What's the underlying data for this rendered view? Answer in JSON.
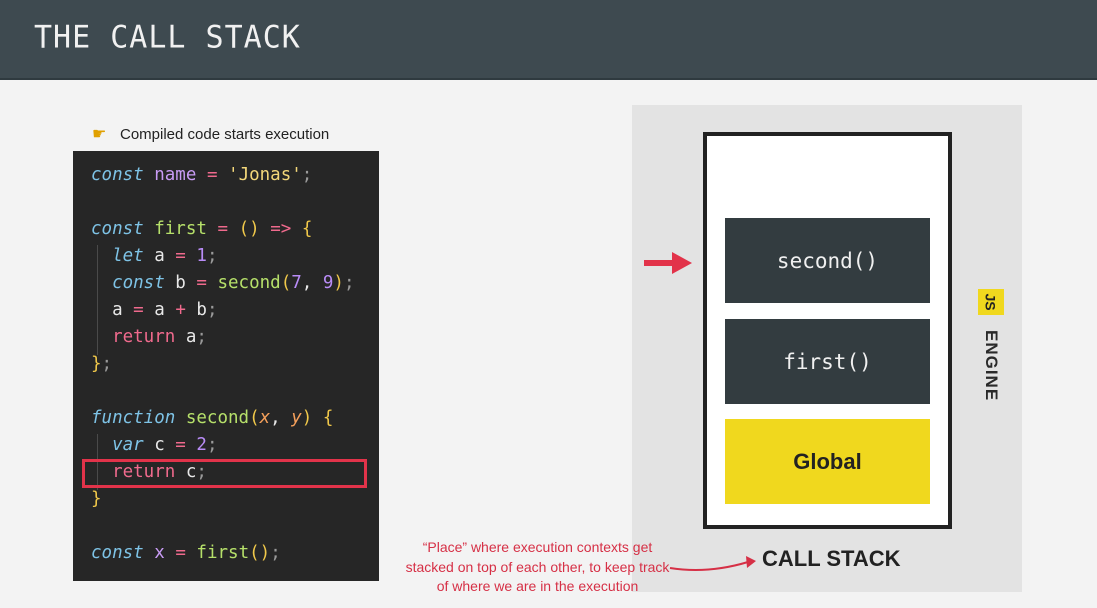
{
  "header": {
    "title": "THE CALL STACK"
  },
  "hint": {
    "icon": "pointing-hand-icon",
    "text": "Compiled code starts execution"
  },
  "code": {
    "lines": [
      [
        [
          "kw",
          "const"
        ],
        [
          "plain",
          " "
        ],
        [
          "var",
          "name"
        ],
        [
          "plain",
          " "
        ],
        [
          "op",
          "="
        ],
        [
          "plain",
          " "
        ],
        [
          "str",
          "'Jonas'"
        ],
        [
          "semi",
          ";"
        ]
      ],
      [],
      [
        [
          "kw",
          "const"
        ],
        [
          "plain",
          " "
        ],
        [
          "fn",
          "first"
        ],
        [
          "plain",
          " "
        ],
        [
          "op",
          "="
        ],
        [
          "plain",
          " "
        ],
        [
          "brace",
          "()"
        ],
        [
          "plain",
          " "
        ],
        [
          "op",
          "=>"
        ],
        [
          "plain",
          " "
        ],
        [
          "brace",
          "{"
        ]
      ],
      [
        [
          "plain",
          "  "
        ],
        [
          "kw",
          "let"
        ],
        [
          "plain",
          " a "
        ],
        [
          "op",
          "="
        ],
        [
          "plain",
          " "
        ],
        [
          "num",
          "1"
        ],
        [
          "semi",
          ";"
        ]
      ],
      [
        [
          "plain",
          "  "
        ],
        [
          "kw",
          "const"
        ],
        [
          "plain",
          " b "
        ],
        [
          "op",
          "="
        ],
        [
          "plain",
          " "
        ],
        [
          "fn",
          "second"
        ],
        [
          "brace",
          "("
        ],
        [
          "num",
          "7"
        ],
        [
          "plain",
          ", "
        ],
        [
          "num",
          "9"
        ],
        [
          "brace",
          ")"
        ],
        [
          "semi",
          ";"
        ]
      ],
      [
        [
          "plain",
          "  a "
        ],
        [
          "op",
          "="
        ],
        [
          "plain",
          " a "
        ],
        [
          "op",
          "+"
        ],
        [
          "plain",
          " b"
        ],
        [
          "semi",
          ";"
        ]
      ],
      [
        [
          "plain",
          "  "
        ],
        [
          "ret",
          "return"
        ],
        [
          "plain",
          " a"
        ],
        [
          "semi",
          ";"
        ]
      ],
      [
        [
          "brace",
          "}"
        ],
        [
          "semi",
          ";"
        ]
      ],
      [],
      [
        [
          "kw",
          "function"
        ],
        [
          "plain",
          " "
        ],
        [
          "fn",
          "second"
        ],
        [
          "brace",
          "("
        ],
        [
          "param",
          "x"
        ],
        [
          "plain",
          ", "
        ],
        [
          "param",
          "y"
        ],
        [
          "brace",
          ")"
        ],
        [
          "plain",
          " "
        ],
        [
          "brace",
          "{"
        ]
      ],
      [
        [
          "plain",
          "  "
        ],
        [
          "kw",
          "var"
        ],
        [
          "plain",
          " c "
        ],
        [
          "op",
          "="
        ],
        [
          "plain",
          " "
        ],
        [
          "num",
          "2"
        ],
        [
          "semi",
          ";"
        ]
      ],
      [
        [
          "plain",
          "  "
        ],
        [
          "ret",
          "return"
        ],
        [
          "plain",
          " c"
        ],
        [
          "semi",
          ";"
        ]
      ],
      [
        [
          "brace",
          "}"
        ]
      ],
      [],
      [
        [
          "kw",
          "const"
        ],
        [
          "plain",
          " "
        ],
        [
          "var",
          "x"
        ],
        [
          "plain",
          " "
        ],
        [
          "op",
          "="
        ],
        [
          "plain",
          " "
        ],
        [
          "fn",
          "first"
        ],
        [
          "brace",
          "()"
        ],
        [
          "semi",
          ";"
        ]
      ]
    ]
  },
  "stack": {
    "frames": [
      {
        "label": "second()",
        "style": "dark"
      },
      {
        "label": "first()",
        "style": "dark"
      },
      {
        "label": "Global",
        "style": "global"
      }
    ],
    "label": "CALL STACK"
  },
  "engine": {
    "badge": "JS",
    "label": "ENGINE"
  },
  "note": {
    "text": "“Place” where execution contexts get stacked on top of each other, to keep track of where we are in the execution"
  },
  "colors": {
    "accent_red": "#e2334a",
    "js_yellow": "#f0d81e",
    "frame_dark": "#333c40",
    "header_bg": "#3e4a50"
  }
}
